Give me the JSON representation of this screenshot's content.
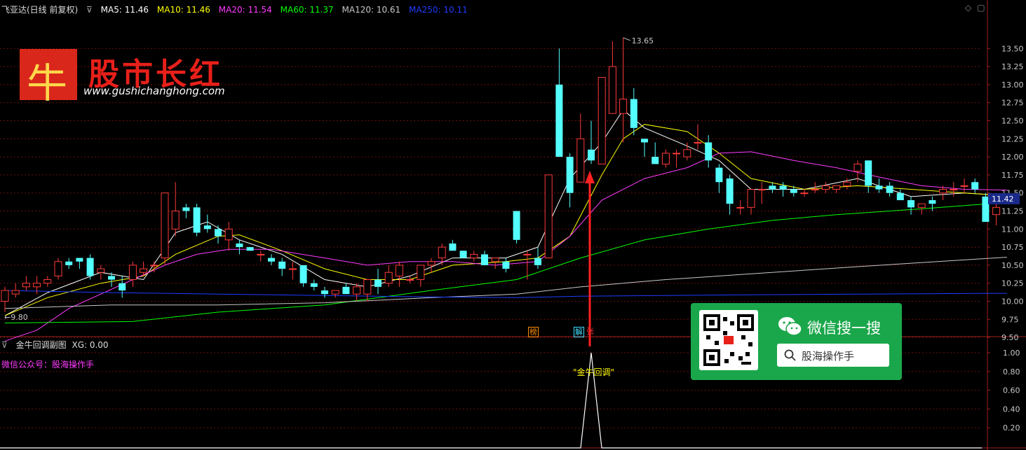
{
  "header": {
    "stock_label": "飞亚达(日线 前复权)",
    "ma": [
      {
        "label": "MA5: 11.46",
        "color": "#ffffff"
      },
      {
        "label": "MA10: 11.46",
        "color": "#ffff00"
      },
      {
        "label": "MA20: 11.54",
        "color": "#ff3cff"
      },
      {
        "label": "MA60: 11.37",
        "color": "#00ff00"
      },
      {
        "label": "MA120: 10.61",
        "color": "#c8c8c8"
      },
      {
        "label": "MA250: 10.11",
        "color": "#1e3cff"
      }
    ]
  },
  "sub_panel": {
    "title": "金牛回调副图",
    "xg_label": "XG: 0.00",
    "wechat_note": "微信公众号：股海操作手",
    "signal_label": "\"金牛回调\""
  },
  "logo": {
    "char": "牛",
    "name": "股市长红",
    "url": "www.gushichanghong.com"
  },
  "wechat": {
    "title": "微信搜一搜",
    "search_text": "股海操作手"
  },
  "badges": [
    {
      "text": "榜",
      "color": "#ff8c00"
    },
    {
      "text": "解",
      "color": "#40e0ff"
    },
    {
      "text": "张",
      "color": "#ff3030"
    }
  ],
  "chart_data": {
    "type": "candlestick",
    "main_axis": {
      "ylim": [
        9.3,
        13.75
      ],
      "ticks": [
        "13.50",
        "13.25",
        "13.00",
        "12.75",
        "12.50",
        "12.25",
        "12.00",
        "11.75",
        "11.50",
        "11.25",
        "11.00",
        "10.75",
        "10.50",
        "10.25",
        "10.00",
        "9.75",
        "9.50"
      ]
    },
    "last_price_label": "11.42",
    "high_label": "13.65",
    "low_label": "9.80",
    "ohlc": [
      [
        10.0,
        10.2,
        9.85,
        10.15
      ],
      [
        10.1,
        10.25,
        10.05,
        10.15
      ],
      [
        10.2,
        10.35,
        10.15,
        10.25
      ],
      [
        10.2,
        10.35,
        10.1,
        10.25
      ],
      [
        10.25,
        10.35,
        10.2,
        10.3
      ],
      [
        10.35,
        10.6,
        10.3,
        10.55
      ],
      [
        10.55,
        10.6,
        10.45,
        10.5
      ],
      [
        10.6,
        10.6,
        10.45,
        10.55
      ],
      [
        10.6,
        10.65,
        10.3,
        10.35
      ],
      [
        10.4,
        10.5,
        10.3,
        10.45
      ],
      [
        10.35,
        10.4,
        10.2,
        10.3
      ],
      [
        10.25,
        10.35,
        10.05,
        10.15
      ],
      [
        10.3,
        10.55,
        10.2,
        10.5
      ],
      [
        10.4,
        10.55,
        10.35,
        10.45
      ],
      [
        10.5,
        10.55,
        10.4,
        10.5
      ],
      [
        10.6,
        11.5,
        10.5,
        11.5
      ],
      [
        11.0,
        11.65,
        10.9,
        11.25
      ],
      [
        11.3,
        11.35,
        11.15,
        11.25
      ],
      [
        11.3,
        11.35,
        10.9,
        10.95
      ],
      [
        11.05,
        11.2,
        10.95,
        11.0
      ],
      [
        11.0,
        11.05,
        10.8,
        10.9
      ],
      [
        10.85,
        11.1,
        10.7,
        11.0
      ],
      [
        10.8,
        10.85,
        10.65,
        10.75
      ],
      [
        10.75,
        10.75,
        10.7,
        10.7
      ],
      [
        10.65,
        10.7,
        10.55,
        10.65
      ],
      [
        10.6,
        10.65,
        10.5,
        10.55
      ],
      [
        10.55,
        10.6,
        10.35,
        10.45
      ],
      [
        10.45,
        10.55,
        10.3,
        10.45
      ],
      [
        10.5,
        10.5,
        10.2,
        10.25
      ],
      [
        10.25,
        10.3,
        10.15,
        10.2
      ],
      [
        10.15,
        10.2,
        10.05,
        10.1
      ],
      [
        10.1,
        10.15,
        10.05,
        10.15
      ],
      [
        10.2,
        10.25,
        10.1,
        10.1
      ],
      [
        10.1,
        10.25,
        10.0,
        10.2
      ],
      [
        10.1,
        10.3,
        10.0,
        10.3
      ],
      [
        10.3,
        10.45,
        10.1,
        10.2
      ],
      [
        10.25,
        10.5,
        10.2,
        10.4
      ],
      [
        10.35,
        10.55,
        10.2,
        10.5
      ],
      [
        10.3,
        10.35,
        10.25,
        10.3
      ],
      [
        10.3,
        10.5,
        10.2,
        10.5
      ],
      [
        10.5,
        10.6,
        10.4,
        10.55
      ],
      [
        10.6,
        10.8,
        10.5,
        10.75
      ],
      [
        10.8,
        10.85,
        10.7,
        10.7
      ],
      [
        10.7,
        10.7,
        10.6,
        10.6
      ],
      [
        10.6,
        10.7,
        10.55,
        10.65
      ],
      [
        10.65,
        10.7,
        10.5,
        10.5
      ],
      [
        10.55,
        10.6,
        10.45,
        10.6
      ],
      [
        10.55,
        10.6,
        10.4,
        10.45
      ],
      [
        11.25,
        11.25,
        10.8,
        10.85
      ],
      [
        10.65,
        10.7,
        10.3,
        10.65
      ],
      [
        10.6,
        10.75,
        10.45,
        10.5
      ],
      [
        10.6,
        11.75,
        10.6,
        11.75
      ],
      [
        13.0,
        13.5,
        12.0,
        12.0
      ],
      [
        12.0,
        12.05,
        11.3,
        11.5
      ],
      [
        11.65,
        12.6,
        11.65,
        12.25
      ],
      [
        12.1,
        12.5,
        11.9,
        11.95
      ],
      [
        11.9,
        13.1,
        11.9,
        13.1
      ],
      [
        12.6,
        13.6,
        12.6,
        13.25
      ],
      [
        12.6,
        13.65,
        12.2,
        12.8
      ],
      [
        12.8,
        12.95,
        12.3,
        12.4
      ],
      [
        12.25,
        12.25,
        12.0,
        12.2
      ],
      [
        12.0,
        12.2,
        11.95,
        11.9
      ],
      [
        11.9,
        12.1,
        11.85,
        12.05
      ],
      [
        12.05,
        12.1,
        11.85,
        12.05
      ],
      [
        12.0,
        12.2,
        11.95,
        12.1
      ],
      [
        12.2,
        12.45,
        12.1,
        12.2
      ],
      [
        12.2,
        12.3,
        11.85,
        11.95
      ],
      [
        11.85,
        11.9,
        11.5,
        11.65
      ],
      [
        11.7,
        11.75,
        11.2,
        11.35
      ],
      [
        11.3,
        11.4,
        11.2,
        11.3
      ],
      [
        11.3,
        11.55,
        11.2,
        11.55
      ],
      [
        11.55,
        11.65,
        11.35,
        11.55
      ],
      [
        11.6,
        11.65,
        11.5,
        11.55
      ],
      [
        11.6,
        11.65,
        11.45,
        11.55
      ],
      [
        11.55,
        11.6,
        11.45,
        11.5
      ],
      [
        11.5,
        11.55,
        11.45,
        11.5
      ],
      [
        11.55,
        11.65,
        11.5,
        11.55
      ],
      [
        11.55,
        11.65,
        11.5,
        11.6
      ],
      [
        11.55,
        11.6,
        11.5,
        11.6
      ],
      [
        11.6,
        11.7,
        11.55,
        11.65
      ],
      [
        11.8,
        11.95,
        11.65,
        11.9
      ],
      [
        11.95,
        11.95,
        11.5,
        11.6
      ],
      [
        11.6,
        11.7,
        11.5,
        11.55
      ],
      [
        11.6,
        11.65,
        11.45,
        11.5
      ],
      [
        11.5,
        11.55,
        11.4,
        11.4
      ],
      [
        11.4,
        11.45,
        11.2,
        11.3
      ],
      [
        11.3,
        11.35,
        11.2,
        11.35
      ],
      [
        11.4,
        11.45,
        11.25,
        11.35
      ],
      [
        11.5,
        11.6,
        11.4,
        11.55
      ],
      [
        11.55,
        11.65,
        11.45,
        11.55
      ],
      [
        11.6,
        11.7,
        11.5,
        11.6
      ],
      [
        11.65,
        11.7,
        11.5,
        11.55
      ],
      [
        11.45,
        11.5,
        11.1,
        11.1
      ],
      [
        11.2,
        11.35,
        11.05,
        11.3
      ]
    ],
    "ma_series": [
      {
        "name": "MA5",
        "color": "#ffffff",
        "values": [
          [
            0,
            9.8
          ],
          [
            4,
            10.12
          ],
          [
            9,
            10.4
          ],
          [
            13,
            10.3
          ],
          [
            16,
            10.95
          ],
          [
            19,
            11.1
          ],
          [
            22,
            10.85
          ],
          [
            26,
            10.65
          ],
          [
            30,
            10.3
          ],
          [
            34,
            10.2
          ],
          [
            38,
            10.35
          ],
          [
            42,
            10.6
          ],
          [
            47,
            10.6
          ],
          [
            50,
            10.75
          ],
          [
            53,
            11.7
          ],
          [
            56,
            12.2
          ],
          [
            58,
            12.65
          ],
          [
            60,
            12.4
          ],
          [
            64,
            12.15
          ],
          [
            67,
            11.95
          ],
          [
            70,
            11.55
          ],
          [
            75,
            11.55
          ],
          [
            80,
            11.7
          ],
          [
            85,
            11.45
          ],
          [
            90,
            11.5
          ],
          [
            94,
            11.46
          ]
        ]
      },
      {
        "name": "MA10",
        "color": "#ffff00",
        "values": [
          [
            0,
            9.8
          ],
          [
            4,
            10.05
          ],
          [
            9,
            10.25
          ],
          [
            13,
            10.35
          ],
          [
            16,
            10.65
          ],
          [
            20,
            10.9
          ],
          [
            22,
            10.92
          ],
          [
            26,
            10.7
          ],
          [
            30,
            10.45
          ],
          [
            34,
            10.3
          ],
          [
            38,
            10.3
          ],
          [
            42,
            10.5
          ],
          [
            47,
            10.55
          ],
          [
            50,
            10.6
          ],
          [
            53,
            10.9
          ],
          [
            56,
            11.75
          ],
          [
            58,
            12.25
          ],
          [
            60,
            12.45
          ],
          [
            64,
            12.35
          ],
          [
            67,
            12.05
          ],
          [
            70,
            11.7
          ],
          [
            75,
            11.55
          ],
          [
            80,
            11.6
          ],
          [
            85,
            11.55
          ],
          [
            90,
            11.5
          ],
          [
            94,
            11.46
          ]
        ]
      },
      {
        "name": "MA20",
        "color": "#ff3cff",
        "values": [
          [
            0,
            9.45
          ],
          [
            3,
            9.6
          ],
          [
            6,
            9.9
          ],
          [
            9,
            10.1
          ],
          [
            12,
            10.3
          ],
          [
            15,
            10.5
          ],
          [
            18,
            10.65
          ],
          [
            21,
            10.72
          ],
          [
            25,
            10.72
          ],
          [
            30,
            10.6
          ],
          [
            34,
            10.5
          ],
          [
            38,
            10.55
          ],
          [
            42,
            10.55
          ],
          [
            46,
            10.5
          ],
          [
            50,
            10.55
          ],
          [
            53,
            10.9
          ],
          [
            56,
            11.4
          ],
          [
            60,
            11.7
          ],
          [
            64,
            11.85
          ],
          [
            67,
            12.05
          ],
          [
            70,
            12.07
          ],
          [
            74,
            11.95
          ],
          [
            78,
            11.85
          ],
          [
            82,
            11.72
          ],
          [
            86,
            11.6
          ],
          [
            90,
            11.55
          ],
          [
            94,
            11.54
          ]
        ]
      },
      {
        "name": "MA60",
        "color": "#00ff00",
        "values": [
          [
            0,
            9.7
          ],
          [
            12,
            9.72
          ],
          [
            20,
            9.85
          ],
          [
            30,
            9.95
          ],
          [
            40,
            10.15
          ],
          [
            48,
            10.3
          ],
          [
            54,
            10.6
          ],
          [
            60,
            10.85
          ],
          [
            66,
            11.0
          ],
          [
            72,
            11.12
          ],
          [
            78,
            11.2
          ],
          [
            86,
            11.28
          ],
          [
            94,
            11.37
          ]
        ]
      },
      {
        "name": "MA120",
        "color": "#c8c8c8",
        "values": [
          [
            0,
            9.9
          ],
          [
            10,
            9.95
          ],
          [
            20,
            9.95
          ],
          [
            30,
            9.98
          ],
          [
            40,
            10.05
          ],
          [
            48,
            10.1
          ],
          [
            54,
            10.2
          ],
          [
            62,
            10.3
          ],
          [
            70,
            10.38
          ],
          [
            80,
            10.48
          ],
          [
            94,
            10.61
          ]
        ]
      },
      {
        "name": "MA250",
        "color": "#1e3cff",
        "values": [
          [
            0,
            10.15
          ],
          [
            10,
            10.12
          ],
          [
            20,
            10.1
          ],
          [
            30,
            10.08
          ],
          [
            40,
            10.06
          ],
          [
            48,
            10.05
          ],
          [
            54,
            10.07
          ],
          [
            62,
            10.08
          ],
          [
            70,
            10.09
          ],
          [
            80,
            10.1
          ],
          [
            94,
            10.11
          ]
        ]
      }
    ],
    "sub_axis": {
      "ylim": [
        0,
        1.1
      ],
      "ticks": [
        "1.00",
        "0.80",
        "0.60",
        "0.40",
        "0.20"
      ]
    },
    "signal": {
      "index": 55,
      "value": 1.0
    }
  }
}
